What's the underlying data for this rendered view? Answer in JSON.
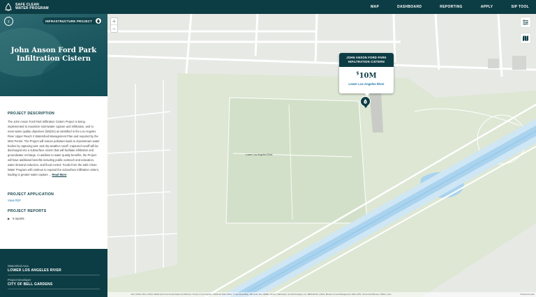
{
  "header": {
    "logo_line1": "SAFE CLEAN",
    "logo_line2": "WATER PROGRAM",
    "nav": [
      "MAP",
      "DASHBOARD",
      "REPORTING",
      "APPLY",
      "SIP TOOL"
    ]
  },
  "project": {
    "category_badge": "INFRASTRUCTURE PROJECT",
    "title_line1": "John Anson Ford Park",
    "title_line2": "Infiltration Cistern"
  },
  "description": {
    "heading": "PROJECT DESCRIPTION",
    "text": "The John Anson Ford Park Infiltration Cistern Project is being implemented to maximize stormwater capture and infiltration, and to meet water quality objectives (WQOs) as identified in the Los Angeles River Upper Reach 2 Watershed Management Plan and required by the MS4 Permit. The Project will reduce pollutant loads to downstream water bodies by capturing wet- and dry-weather runoff. Captured runoff will be discharged into a subsurface cistern that will facilitate infiltration and groundwater recharge. In addition to water quality benefits, the Project will have additional benefits including public outreach and education, water demand reduction, and flood control. Funds from the Safe Clean Water Program will continue to expand the subsurface infiltration cistern, leading to greater water capture ...",
    "read_more": "Read More"
  },
  "application": {
    "heading": "PROJECT APPLICATION",
    "link": "View PDF"
  },
  "reports": {
    "heading": "PROJECT REPORTS",
    "count": "6 reports"
  },
  "info": {
    "watershed_label": "Watershed Area",
    "watershed_value": "LOWER LOS ANGELES RIVER",
    "developer_label": "Project Developer",
    "developer_value": "CITY OF BELL GARDENS"
  },
  "map": {
    "popup_title_line1": "JOHN ANSON FORD PARK",
    "popup_title_line2": "INFILTRATION CISTERN",
    "popup_currency": "$",
    "popup_amount": "10M",
    "popup_area": "Lower Los Angeles River",
    "river_label": "Lower Los Angeles River",
    "attribution": "Esri, NASA, NGA, USGS, FEMA | Esri Community Maps Contributors, County of Los Angeles, California State Parks, © OpenStreetMap, Microsoft, Esri, HERE, Garmin, SafeGraph, GeoTechnologies, Inc, METI/NASA, USGS, Bureau of Land Management, EPA, NPS, US Census Bureau, USDA | more",
    "powered_by": "Powered by Esri",
    "zoom_in": "+",
    "zoom_out": "−"
  },
  "colors": {
    "brand_dark": "#0d3d44",
    "link_blue": "#1a73a8",
    "park_green": "#d9e6d2",
    "water_blue": "#a9d3ee"
  }
}
